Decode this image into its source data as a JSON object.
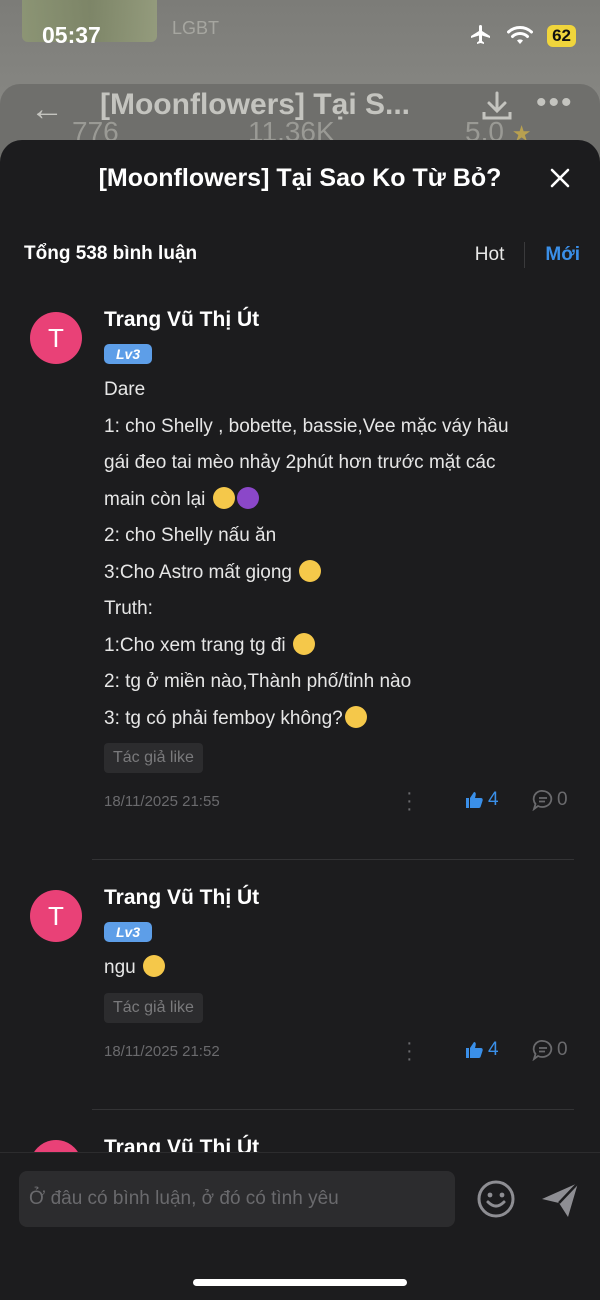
{
  "status_bar": {
    "time": "05:37",
    "battery": "62"
  },
  "background": {
    "label": "LGBT",
    "title": "[Moonflowers] Tại S...",
    "stats": [
      "776",
      "11.36K",
      "5.0"
    ]
  },
  "sheet": {
    "title": "[Moonflowers] Tại Sao Ko Từ Bỏ?",
    "total": "Tổng 538 bình luận",
    "sort_hot": "Hot",
    "sort_new": "Mới"
  },
  "comments": [
    {
      "avatar": "T",
      "name": "Trang Vũ Thị Út",
      "level": "Lv3",
      "lines": [
        "Dare",
        "1: cho Shelly , bobette, bassie,Vee mặc váy hầu",
        "gái đeo tai mèo nhảy 2phút hơn trước mặt các",
        "main còn lại",
        "2: cho Shelly nấu ăn",
        "3:Cho Astro mất giọng",
        "Truth:",
        "1:Cho xem trang tg đi",
        "2: tg ở miền nào,Thành phố/tỉnh nào",
        "3: tg có phải femboy không?"
      ],
      "author_like": "Tác giả like",
      "date": "18/11/2025 21:55",
      "likes": "4",
      "replies": "0"
    },
    {
      "avatar": "T",
      "name": "Trang Vũ Thị Út",
      "level": "Lv3",
      "lines": [
        "ngu"
      ],
      "author_like": "Tác giả like",
      "date": "18/11/2025 21:52",
      "likes": "4",
      "replies": "0"
    },
    {
      "avatar": "T",
      "name": "Trang Vũ Thị Út"
    }
  ],
  "composer": {
    "placeholder": "Ở đâu có bình luận, ở đó có tình yêu"
  },
  "icons": [
    "back-arrow-icon",
    "download-icon",
    "more-icon",
    "airplane-icon",
    "wifi-icon",
    "battery-icon",
    "close-icon",
    "thumbs-up-icon",
    "comment-bubble-icon",
    "emoji-icon",
    "send-icon"
  ],
  "colors": {
    "avatar": "#e94177",
    "accent": "#3a8fe8",
    "level_badge": "#5d9ee8",
    "sheet_bg": "#1c1c1e"
  }
}
